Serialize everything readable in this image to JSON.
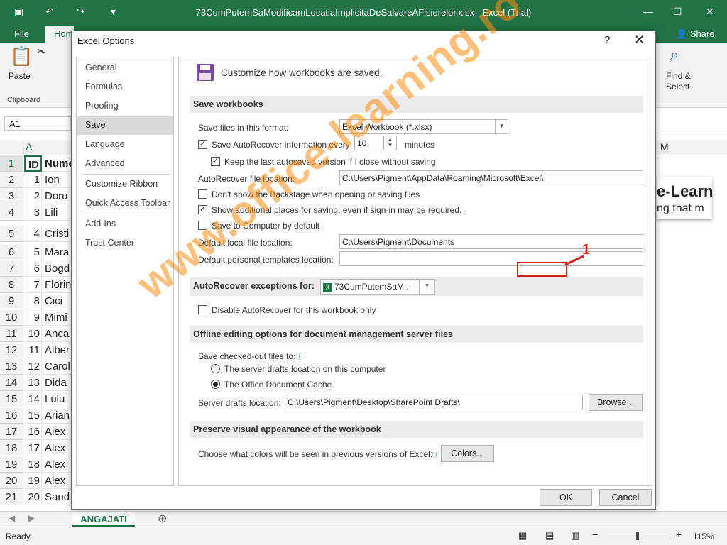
{
  "excel": {
    "title": "73CumPutemSaModificamLocatiaImplicitaDeSalvareAFisierelor.xlsx - Excel (Trial)",
    "file_tab": "File",
    "home_tab": "Home",
    "share_label": "Share",
    "paste_label": "Paste",
    "clipboard_label": "Clipboard",
    "find_select_label": "Find &\nSelect",
    "namebox": "A1",
    "columns": [
      "A",
      "M"
    ],
    "rows": [
      {
        "n": "1",
        "id": "ID",
        "name": "Nume"
      },
      {
        "n": "2",
        "id": "1",
        "name": "Ion"
      },
      {
        "n": "3",
        "id": "2",
        "name": "Doru"
      },
      {
        "n": "4",
        "id": "3",
        "name": "Lili"
      },
      {
        "n": "5",
        "id": "4",
        "name": "Cristi"
      },
      {
        "n": "6",
        "id": "5",
        "name": "Mara"
      },
      {
        "n": "7",
        "id": "6",
        "name": "Bogd"
      },
      {
        "n": "8",
        "id": "7",
        "name": "Florin"
      },
      {
        "n": "9",
        "id": "8",
        "name": "Cici"
      },
      {
        "n": "10",
        "id": "9",
        "name": "Mimi"
      },
      {
        "n": "11",
        "id": "10",
        "name": "Anca"
      },
      {
        "n": "12",
        "id": "11",
        "name": "Alber"
      },
      {
        "n": "13",
        "id": "12",
        "name": "Carol"
      },
      {
        "n": "14",
        "id": "13",
        "name": "Dida"
      },
      {
        "n": "15",
        "id": "14",
        "name": "Lulu"
      },
      {
        "n": "16",
        "id": "15",
        "name": "Arian"
      },
      {
        "n": "17",
        "id": "16",
        "name": "Alex"
      },
      {
        "n": "18",
        "id": "17",
        "name": "Alex"
      },
      {
        "n": "19",
        "id": "18",
        "name": "Alex"
      },
      {
        "n": "20",
        "id": "19",
        "name": "Alex"
      },
      {
        "n": "21",
        "id": "20",
        "name": "Sand"
      }
    ],
    "right_text_1": "e-Learn",
    "right_text_2": "ng that m",
    "sheet_tab": "ANGAJATI",
    "status": "Ready",
    "zoom": "115%"
  },
  "dialog": {
    "title": "Excel Options",
    "help": "?",
    "close": "✕",
    "nav": [
      "General",
      "Formulas",
      "Proofing",
      "Save",
      "Language",
      "Advanced",
      "Customize Ribbon",
      "Quick Access Toolbar",
      "Add-Ins",
      "Trust Center"
    ],
    "selected_nav": "Save",
    "heading": "Customize how workbooks are saved.",
    "sections": {
      "save": "Save workbooks",
      "autorecover_exceptions": "AutoRecover exceptions for:",
      "offline": "Offline editing options for document management server files",
      "preserve": "Preserve visual appearance of the workbook"
    },
    "save_format_label": "Save files in this format:",
    "save_format_value": "Excel Workbook (*.xlsx)",
    "autorecover_label": "Save AutoRecover information every",
    "autorecover_value": "10",
    "minutes_label": "minutes",
    "keep_last_label": "Keep the last autosaved version if I close without saving",
    "autorecover_location_label": "AutoRecover file location:",
    "autorecover_location_value": "C:\\Users\\Pigment\\AppData\\Roaming\\Microsoft\\Excel\\",
    "backstage_label": "Don't show the Backstage when opening or saving files",
    "additional_places_label": "Show additional places for saving, even if sign-in may be required.",
    "save_to_computer_label": "Save to Computer by default",
    "default_local_label": "Default local file location:",
    "default_local_value": "C:\\Users\\Pigment\\Documents",
    "personal_templates_label": "Default personal templates location:",
    "personal_templates_value": "",
    "exceptions_workbook": "73CumPutemSaM...",
    "disable_autorecover_label": "Disable AutoRecover for this workbook only",
    "checked_out_label": "Save checked-out files to:",
    "server_drafts_radio": "The server drafts location on this computer",
    "office_cache_radio": "The Office Document Cache",
    "server_drafts_label": "Server drafts location:",
    "server_drafts_value": "C:\\Users\\Pigment\\Desktop\\SharePoint Drafts\\",
    "browse": "Browse...",
    "colors_label": "Choose what colors will be seen in previous versions of Excel:",
    "colors_button": "Colors...",
    "ok": "OK",
    "cancel": "Cancel"
  },
  "annotation": {
    "number": "1"
  },
  "watermark": "www.office-learning.ro",
  "colors": {
    "excel_green": "#217346",
    "annotation_red": "#d32020",
    "watermark_orange": "#ff8c14"
  }
}
